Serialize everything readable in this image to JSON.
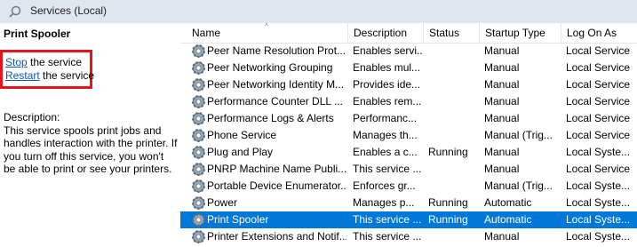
{
  "window": {
    "title": "Services (Local)",
    "icon": "search-icon"
  },
  "left_pane": {
    "title": "Print Spooler",
    "actions": [
      {
        "link": "Stop",
        "rest": " the service"
      },
      {
        "link": "Restart",
        "rest": " the service"
      }
    ],
    "description_heading": "Description:",
    "description_text": "This service spools print jobs and handles interaction with the printer. If you turn off this service, you won't be able to print or see your printers."
  },
  "table": {
    "columns": [
      "Name",
      "Description",
      "Status",
      "Startup Type",
      "Log On As"
    ],
    "sort_indicator": "^",
    "rows": [
      {
        "name": "Peer Name Resolution Prot...",
        "description": "Enables servi...",
        "status": "",
        "startup": "Manual",
        "logon": "Local Service"
      },
      {
        "name": "Peer Networking Grouping",
        "description": "Enables mul...",
        "status": "",
        "startup": "Manual",
        "logon": "Local Service"
      },
      {
        "name": "Peer Networking Identity M...",
        "description": "Provides ide...",
        "status": "",
        "startup": "Manual",
        "logon": "Local Service"
      },
      {
        "name": "Performance Counter DLL ...",
        "description": "Enables rem...",
        "status": "",
        "startup": "Manual",
        "logon": "Local Service"
      },
      {
        "name": "Performance Logs & Alerts",
        "description": "Performanc...",
        "status": "",
        "startup": "Manual",
        "logon": "Local Service"
      },
      {
        "name": "Phone Service",
        "description": "Manages th...",
        "status": "",
        "startup": "Manual (Trig...",
        "logon": "Local Service"
      },
      {
        "name": "Plug and Play",
        "description": "Enables a c...",
        "status": "Running",
        "startup": "Manual",
        "logon": "Local Syste..."
      },
      {
        "name": "PNRP Machine Name Publi...",
        "description": "This service ...",
        "status": "",
        "startup": "Manual",
        "logon": "Local Service"
      },
      {
        "name": "Portable Device Enumerator...",
        "description": "Enforces gr...",
        "status": "",
        "startup": "Manual (Trig...",
        "logon": "Local Syste..."
      },
      {
        "name": "Power",
        "description": "Manages p...",
        "status": "Running",
        "startup": "Automatic",
        "logon": "Local Syste..."
      },
      {
        "name": "Print Spooler",
        "description": "This service ...",
        "status": "Running",
        "startup": "Automatic",
        "logon": "Local Syste...",
        "selected": true
      },
      {
        "name": "Printer Extensions and Notif...",
        "description": "This service ...",
        "status": "",
        "startup": "Manual",
        "logon": "Local Syste..."
      }
    ]
  },
  "colors": {
    "selected_row": "#0078d7",
    "highlight_box": "#e8141b",
    "link": "#0b57b8",
    "titlebar": "#dfe6ee"
  },
  "row_icon": "service-gear-icon"
}
